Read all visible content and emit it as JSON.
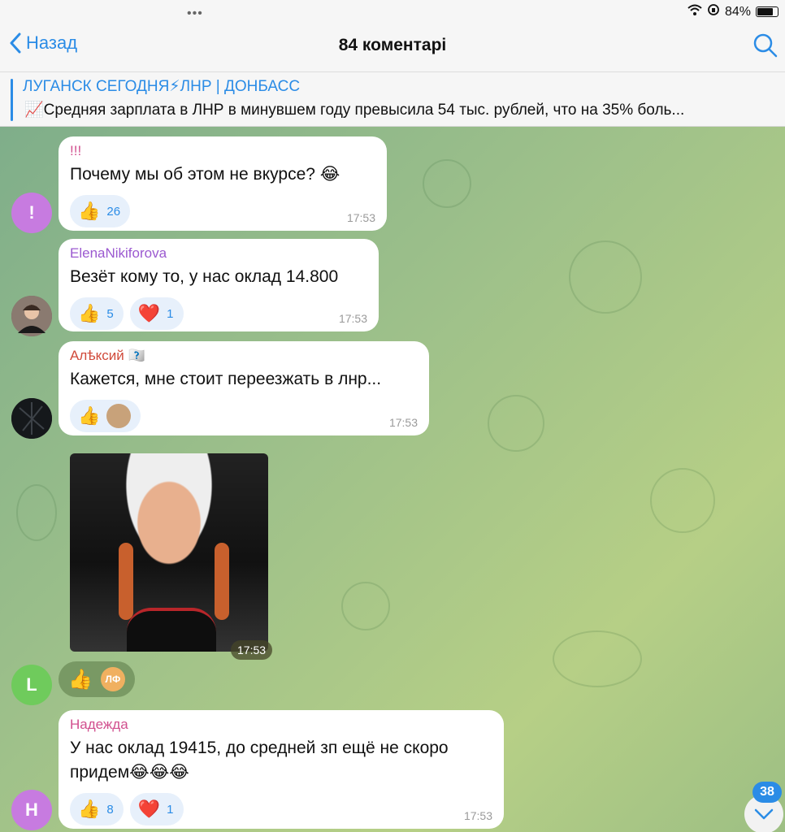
{
  "status": {
    "battery": "84%"
  },
  "header": {
    "back_label": "Назад",
    "title": "84 коментарі"
  },
  "pinned": {
    "channel": "ЛУГАНСК СЕГОДНЯ⚡ЛНР | ДОНБАСС",
    "text": "📈Средняя зарплата в ЛНР в минувшем году превысила 54 тыс. рублей, что на 35% боль..."
  },
  "messages": [
    {
      "avatar": "!",
      "avatar_color": "#c77be0",
      "author": "!!!",
      "author_color": "#d14f8e",
      "text": "Почему мы об этом не вкурсе? 😂",
      "time": "17:53",
      "reactions": [
        {
          "emoji": "👍",
          "count": "26"
        }
      ]
    },
    {
      "avatar": "",
      "avatar_color": "#6b5a55",
      "author": "ElenaNikiforova",
      "author_color": "#9b59d0",
      "text": "Везёт кому то, у нас оклад 14.800",
      "time": "17:53",
      "reactions": [
        {
          "emoji": "👍",
          "count": "5"
        },
        {
          "emoji": "❤️",
          "count": "1"
        }
      ]
    },
    {
      "avatar": "",
      "avatar_color": "#1c1f22",
      "author": "Алѣксий 🇩🇵",
      "author_color": "#d04a3a",
      "text": "Кажется, мне стоит переезжать в лнр...",
      "time": "17:53",
      "reactions": [
        {
          "emoji": "👍",
          "count": ""
        }
      ]
    },
    {
      "avatar": "L",
      "avatar_color": "#6fcb5c",
      "photo_time": "17:53",
      "reactions": [
        {
          "emoji": "👍"
        },
        {
          "mini": "ЛФ"
        }
      ]
    },
    {
      "avatar": "Н",
      "avatar_color": "#c77be0",
      "author": "Надежда",
      "author_color": "#d14f8e",
      "text": "У нас оклад 19415, до средней зп ещё не скоро придем😂😂😂",
      "time": "17:53",
      "reactions": [
        {
          "emoji": "👍",
          "count": "8"
        },
        {
          "emoji": "❤️",
          "count": "1"
        }
      ]
    }
  ],
  "unread_badge": "38"
}
